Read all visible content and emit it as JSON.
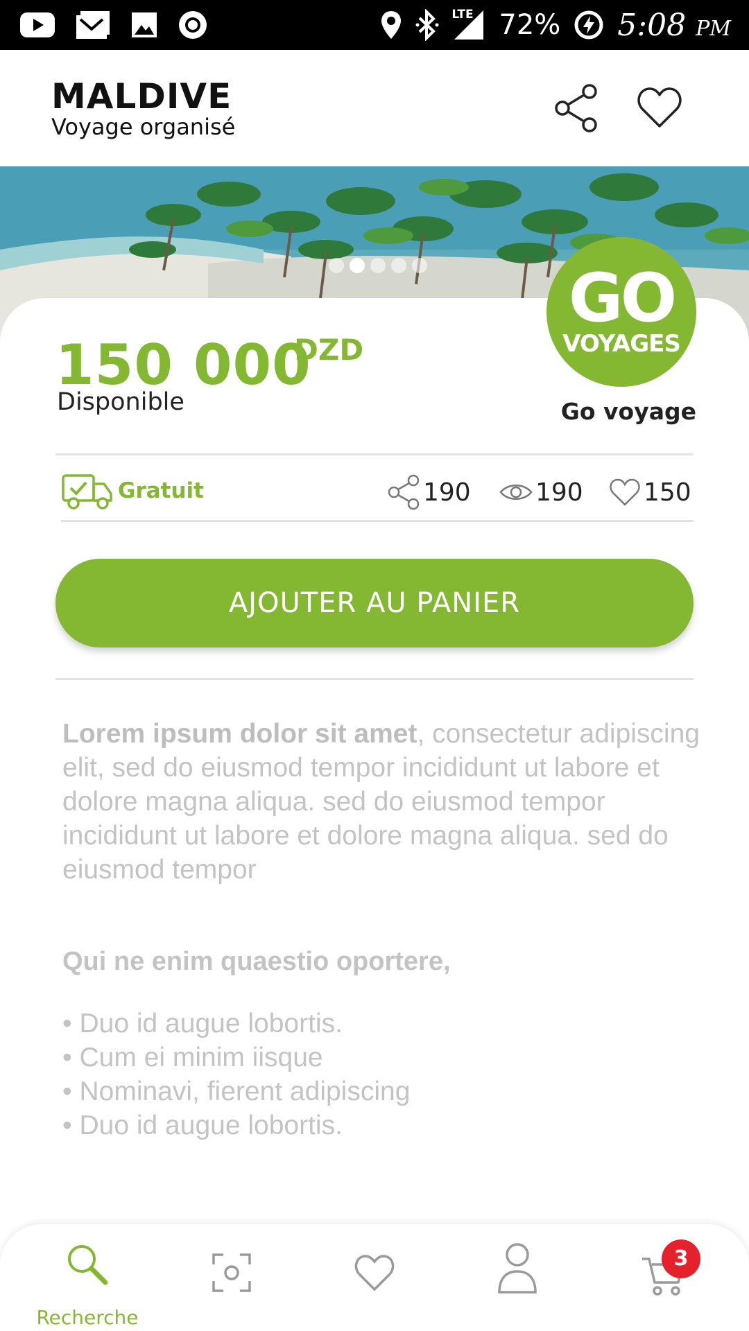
{
  "status_bar": {
    "battery": "72%",
    "time": "5:08",
    "time_suffix": "PM",
    "network": "LTE",
    "left_icons": [
      "youtube-icon",
      "mail-icon",
      "image-icon",
      "record-icon"
    ],
    "right_icons": [
      "location-icon",
      "bluetooth-icon",
      "signal-icon",
      "battery-saver-icon"
    ]
  },
  "header": {
    "title": "MALDIVE",
    "subtitle": "Voyage organisé",
    "icons": [
      "share-icon",
      "heart-icon"
    ]
  },
  "hero": {
    "slide_count": 5,
    "active_slide": 2
  },
  "product": {
    "price": "150 000",
    "currency": "DZD",
    "availability": "Disponible",
    "vendor_logo_top": "GO",
    "vendor_logo_bottom": "VOYAGES",
    "vendor_name": "Go voyage",
    "delivery": "Gratuit",
    "shares": "190",
    "views": "190",
    "likes": "150",
    "add_to_cart": "AJOUTER AU PANIER"
  },
  "description": {
    "lead": "Lorem ipsum dolor sit amet",
    "body": ", consectetur adipiscing elit, sed do eiusmod tempor incididunt ut labore et dolore magna aliqua. sed do eiusmod tempor incididunt ut labore et dolore magna aliqua. sed do eiusmod tempor",
    "subheading": "Qui ne enim quaestio oportere,",
    "bullets": [
      "• Duo id augue lobortis.",
      "• Cum ei minim iisque",
      "• Nominavi, fierent adipiscing",
      "• Duo id augue lobortis."
    ]
  },
  "bottom_nav": {
    "search_label": "Recherche",
    "cart_badge": "3",
    "active_color": "#84b832",
    "inactive_color": "#9a9a9a"
  },
  "colors": {
    "accent": "#84b832",
    "badge": "#e3222b"
  }
}
